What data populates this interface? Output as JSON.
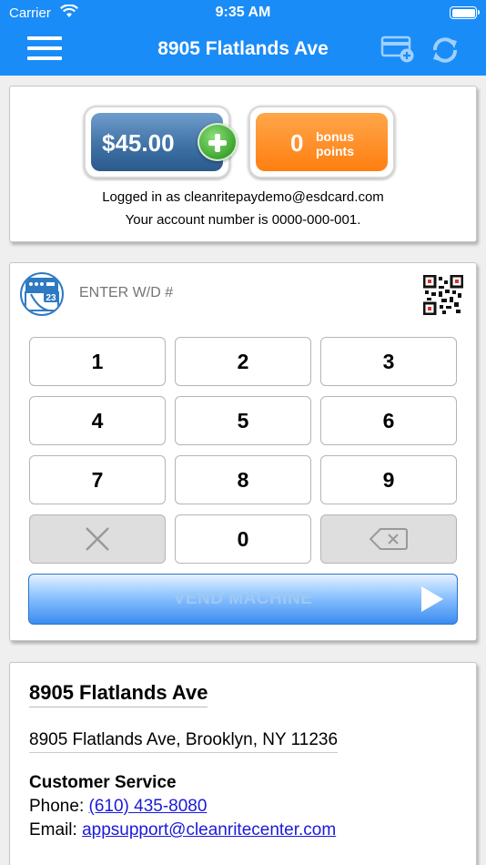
{
  "status_bar": {
    "carrier": "Carrier",
    "time": "9:35 AM"
  },
  "nav": {
    "title": "8905 Flatlands Ave"
  },
  "account": {
    "balance": "$45.00",
    "bonus_points": "0",
    "bonus_label_1": "bonus",
    "bonus_label_2": "points",
    "logged_in_text": "Logged in as cleanritepaydemo@esdcard.com",
    "account_number_text": "Your account number is 0000-000-001."
  },
  "keypad": {
    "input_placeholder": "ENTER W/D #",
    "keys": [
      "1",
      "2",
      "3",
      "4",
      "5",
      "6",
      "7",
      "8",
      "9",
      "0"
    ],
    "vend_label": "VEND MACHINE"
  },
  "location": {
    "title": "8905 Flatlands Ave",
    "address": "8905 Flatlands Ave, Brooklyn, NY 11236",
    "customer_service_heading": "Customer Service",
    "phone_label": "Phone:",
    "phone": "(610) 435-8080",
    "email_label": "Email:",
    "email": "appsupport@cleanritecenter.com"
  },
  "colors": {
    "nav_blue": "#1a8cf7",
    "balance_blue": "#3d6fa3",
    "points_orange": "#ff7f10",
    "add_green": "#3ea52f",
    "link_blue": "#1a1adb"
  },
  "icons": [
    "wifi-icon",
    "battery-icon",
    "menu-icon",
    "add-card-icon",
    "refresh-icon",
    "plus-icon",
    "washer-icon",
    "qr-code-icon",
    "clear-icon",
    "backspace-icon",
    "play-icon"
  ]
}
